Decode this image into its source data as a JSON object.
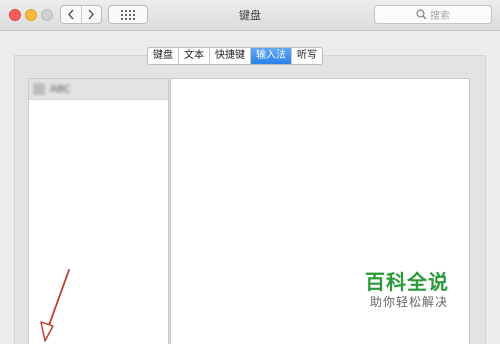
{
  "window": {
    "title": "键盘",
    "search_placeholder": "搜索"
  },
  "toolbar": {
    "back_icon": "chevron-left-icon",
    "forward_icon": "chevron-right-icon",
    "show_all_icon": "grid-icon"
  },
  "tabs": [
    {
      "label": "键盘",
      "active": false
    },
    {
      "label": "文本",
      "active": false
    },
    {
      "label": "快捷键",
      "active": false
    },
    {
      "label": "输入法",
      "active": true
    },
    {
      "label": "听写",
      "active": false
    }
  ],
  "input_sources": {
    "items": [
      {
        "label": "ABC",
        "icon": "input-source-icon"
      }
    ]
  },
  "watermark": {
    "title": "百科全说",
    "subtitle": "助你轻松解决"
  },
  "colors": {
    "accent": "#2c80e8",
    "close": "#fc605c",
    "minimize": "#fdbc40",
    "zoom_disabled": "#cfcfcf",
    "watermark": "#2b9b3a",
    "arrow": "#c0392b"
  }
}
